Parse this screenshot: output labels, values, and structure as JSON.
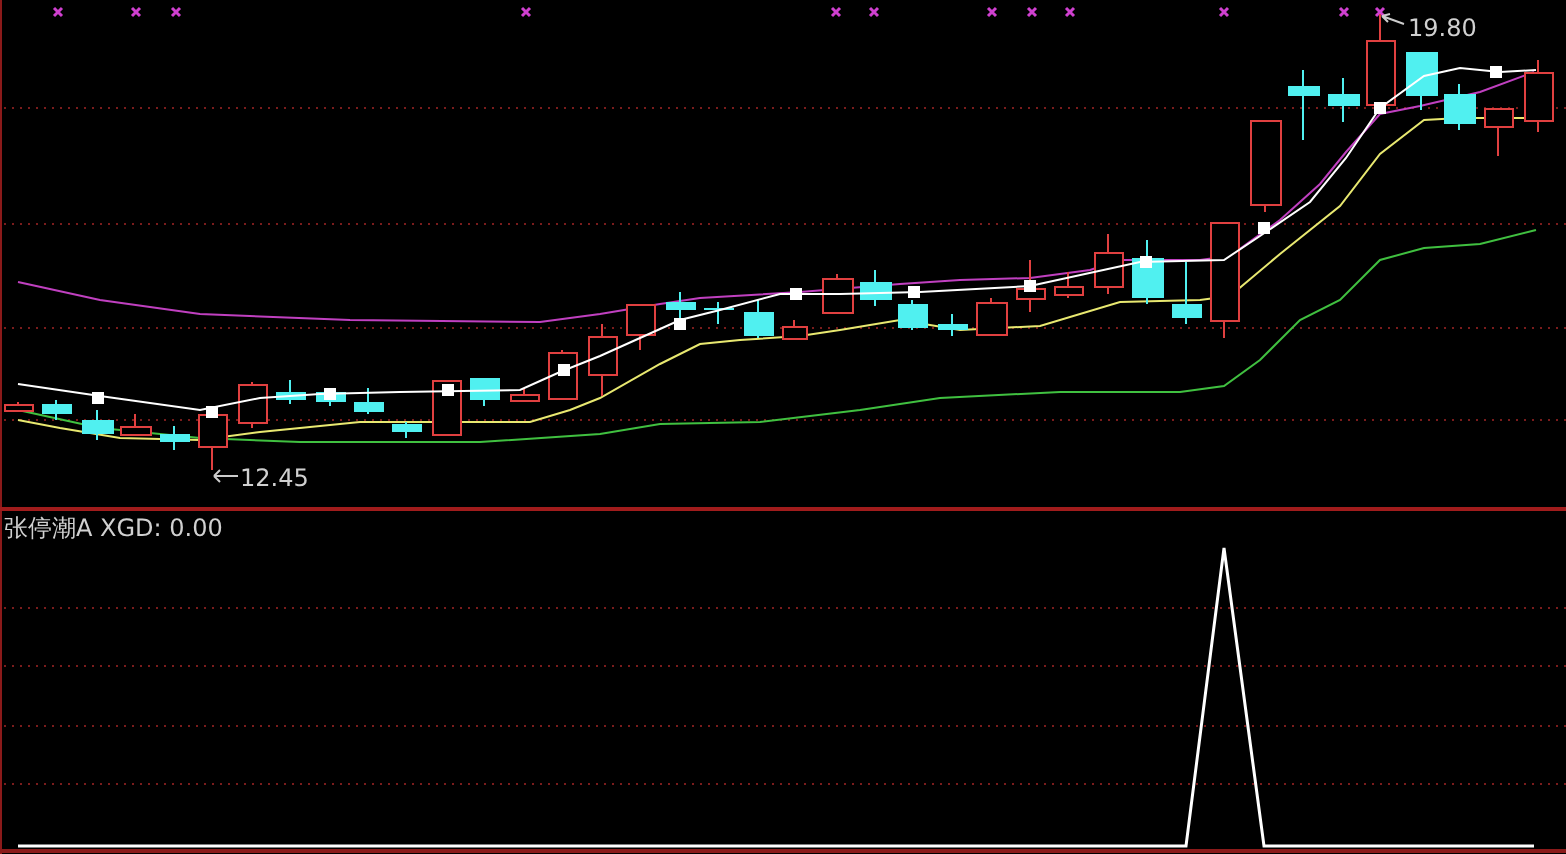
{
  "price_chart": {
    "high_label": "19.80",
    "low_label": "12.45"
  },
  "indicator_panel": {
    "label": "张停潮A XGD: 0.00"
  }
}
